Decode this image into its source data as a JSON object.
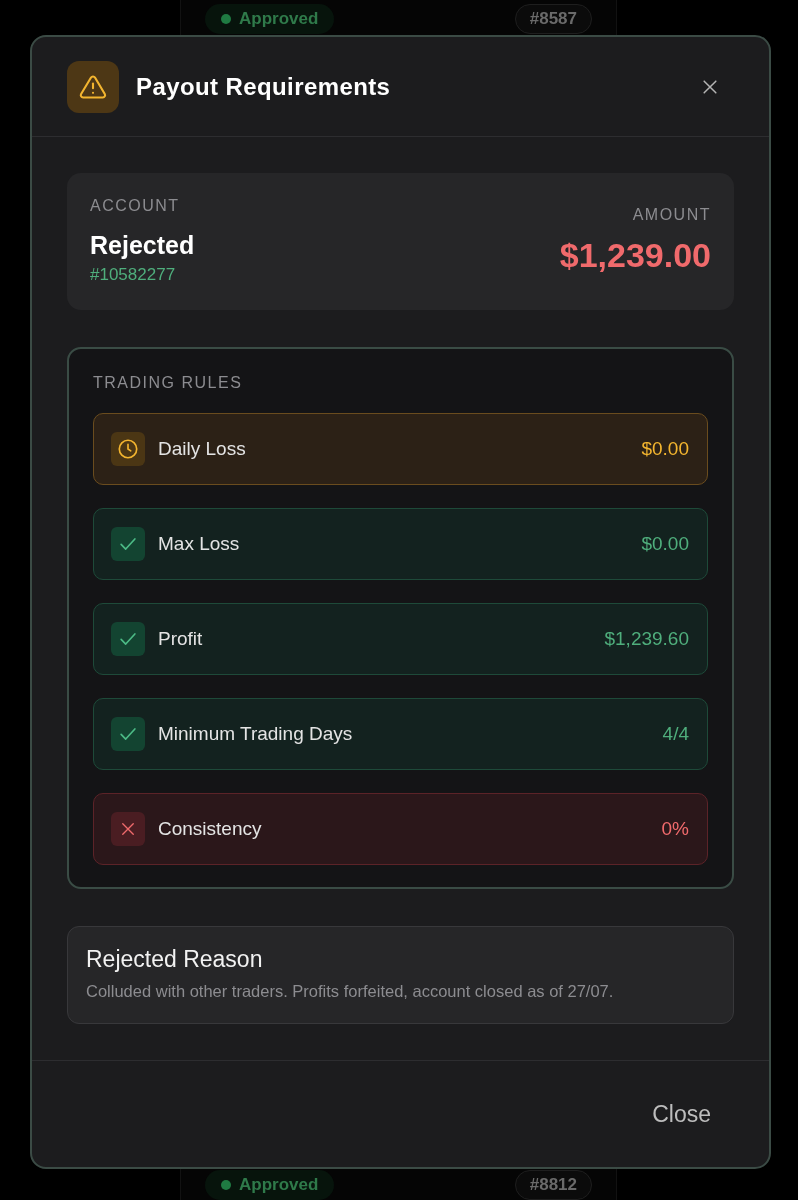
{
  "background": {
    "rows": [
      {
        "status": "Approved",
        "number": "#8587"
      },
      {
        "status": "Approved",
        "number": "#8812"
      }
    ]
  },
  "dialog": {
    "title": "Payout Requirements"
  },
  "account": {
    "label": "ACCOUNT",
    "status": "Rejected",
    "number": "#10582277"
  },
  "amount": {
    "label": "AMOUNT",
    "value": "$1,239.00"
  },
  "trading_rules": {
    "title": "TRADING RULES",
    "rules": [
      {
        "kind": "warning",
        "name": "Daily Loss",
        "value": "$0.00"
      },
      {
        "kind": "passed",
        "name": "Max Loss",
        "value": "$0.00"
      },
      {
        "kind": "passed",
        "name": "Profit",
        "value": "$1,239.60"
      },
      {
        "kind": "passed",
        "name": "Minimum Trading Days",
        "value": "4/4"
      },
      {
        "kind": "failed",
        "name": "Consistency",
        "value": "0%"
      }
    ]
  },
  "rejected_reason": {
    "title": "Rejected Reason",
    "text": "Colluded with other traders. Profits forfeited, account closed as of 27/07."
  },
  "footer": {
    "buttons": [
      "Close"
    ]
  }
}
